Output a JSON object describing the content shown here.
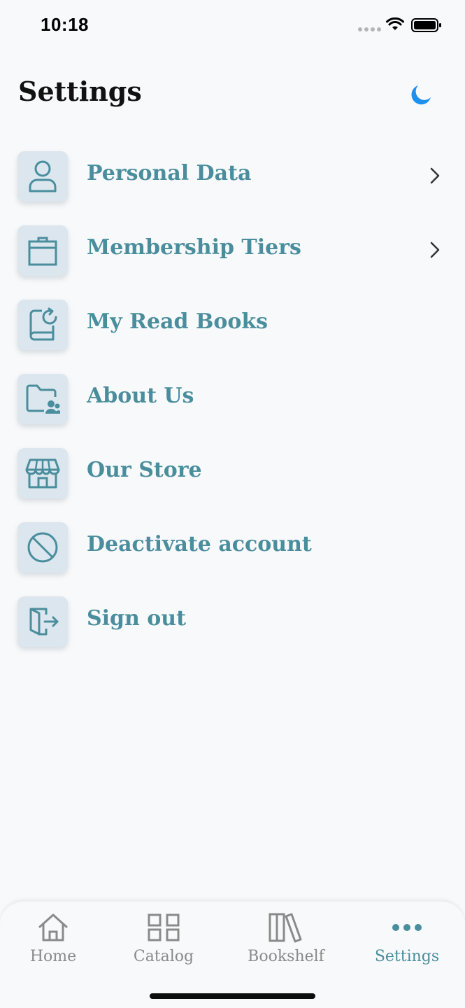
{
  "status_bar": {
    "time": "10:18"
  },
  "header": {
    "title": "Settings",
    "theme_icon": "moon-icon"
  },
  "menu": {
    "items": [
      {
        "label": "Personal Data",
        "icon": "user-icon",
        "has_chevron": true
      },
      {
        "label": "Membership Tiers",
        "icon": "box-icon",
        "has_chevron": true
      },
      {
        "label": "My Read Books",
        "icon": "book-refresh-icon",
        "has_chevron": false
      },
      {
        "label": "About Us",
        "icon": "folder-users-icon",
        "has_chevron": false
      },
      {
        "label": "Our Store",
        "icon": "store-icon",
        "has_chevron": false
      },
      {
        "label": "Deactivate account",
        "icon": "block-icon",
        "has_chevron": false
      },
      {
        "label": "Sign out",
        "icon": "sign-out-icon",
        "has_chevron": false
      }
    ]
  },
  "tab_bar": {
    "tabs": [
      {
        "label": "Home",
        "icon": "home-icon"
      },
      {
        "label": "Catalog",
        "icon": "grid-icon"
      },
      {
        "label": "Bookshelf",
        "icon": "bookshelf-icon"
      },
      {
        "label": "Settings",
        "icon": "more-dots-icon",
        "active": true
      }
    ]
  },
  "colors": {
    "accent": "#4a8e9e",
    "icon_tile": "#dce6ee",
    "moon": "#1e90f0",
    "inactive_tab": "#8a8a8a"
  }
}
